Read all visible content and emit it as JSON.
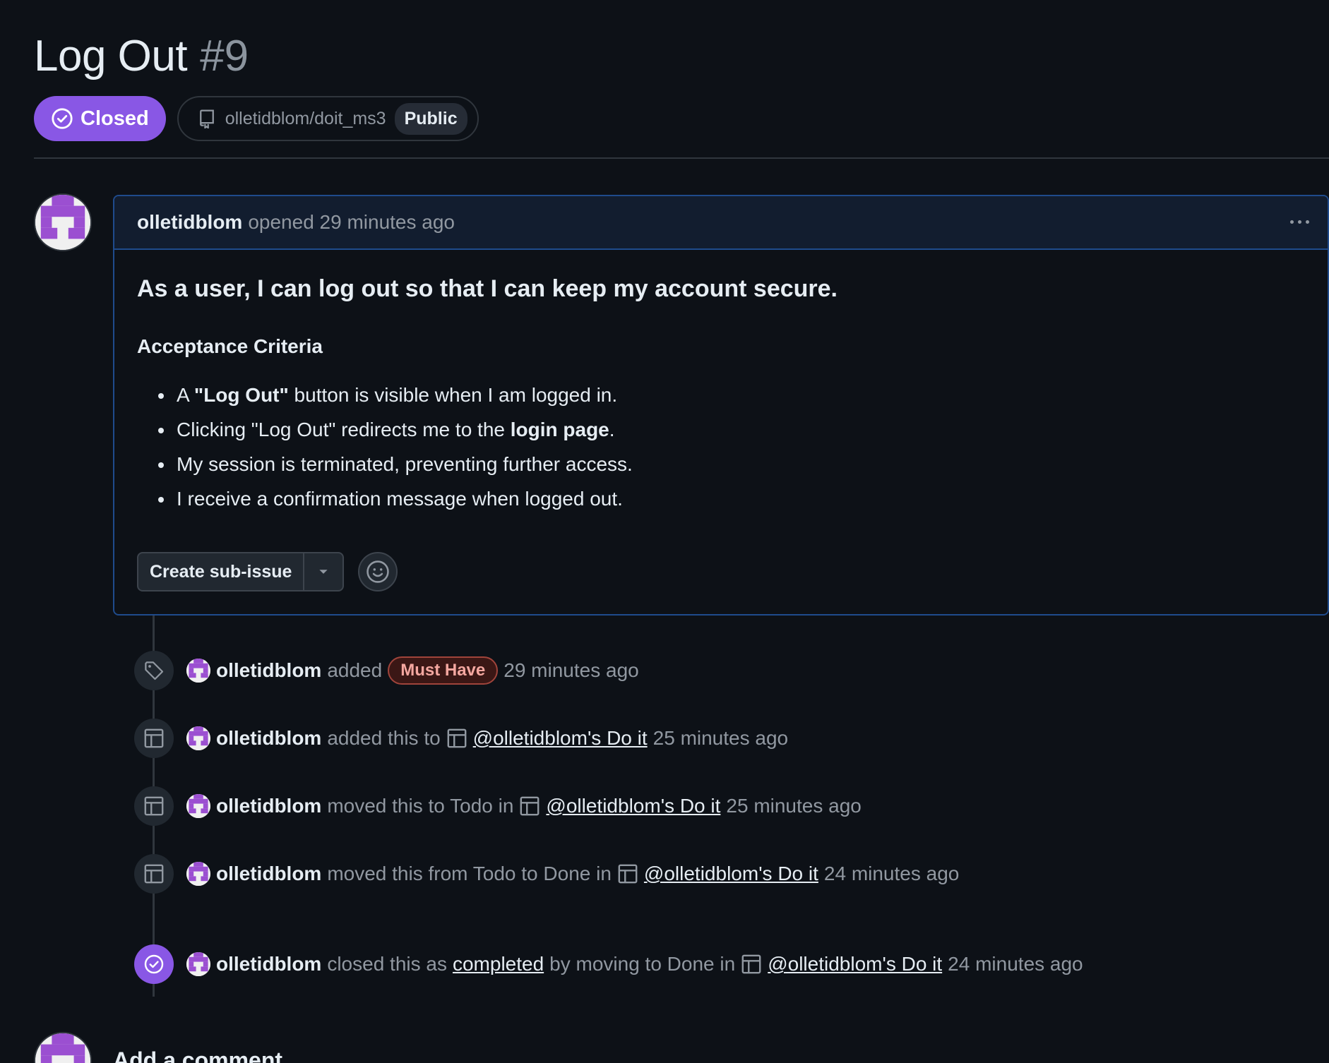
{
  "issue": {
    "title": "Log Out",
    "number": "#9",
    "state": "Closed",
    "repo": "olletidblom/doit_ms3",
    "visibility": "Public"
  },
  "comment": {
    "author": "olletidblom",
    "opened_text": "opened 29 minutes ago",
    "heading": "As a user, I can log out so that I can keep my account secure.",
    "subheading": "Acceptance Criteria",
    "criteria": [
      {
        "pre": "A ",
        "bold": "\"Log Out\"",
        "post": " button is visible when I am logged in."
      },
      {
        "pre": "Clicking \"Log Out\" redirects me to the ",
        "bold": "login page",
        "post": "."
      },
      {
        "pre": "My session is terminated, preventing further access.",
        "bold": "",
        "post": ""
      },
      {
        "pre": "I receive a confirmation message when logged out.",
        "bold": "",
        "post": ""
      }
    ],
    "create_sub_issue_label": "Create sub-issue"
  },
  "timeline": {
    "events": [
      {
        "icon": "tag-icon",
        "author": "olletidblom",
        "verb": "added",
        "label": "Must Have",
        "time": "29 minutes ago"
      },
      {
        "icon": "project-icon",
        "author": "olletidblom",
        "verb": "added this to",
        "link": "@olletidblom's Do it",
        "time": "25 minutes ago"
      },
      {
        "icon": "project-icon",
        "author": "olletidblom",
        "verb": "moved this to Todo in",
        "link": "@olletidblom's Do it",
        "time": "25 minutes ago"
      },
      {
        "icon": "project-icon",
        "author": "olletidblom",
        "verb": "moved this from Todo to Done in",
        "link": "@olletidblom's Do it",
        "time": "24 minutes ago"
      },
      {
        "icon": "check-circle-icon",
        "author": "olletidblom",
        "verb": "closed this as",
        "completed_link": "completed",
        "verb2": "by moving to Done in",
        "link": "@olletidblom's Do it",
        "time": "24 minutes ago"
      }
    ]
  },
  "footer": {
    "add_comment": "Add a comment"
  },
  "colors": {
    "background": "#0d1117",
    "closed_purple": "#8957e5",
    "comment_border": "#1f4b8c",
    "label_text": "#f4a7a0"
  }
}
